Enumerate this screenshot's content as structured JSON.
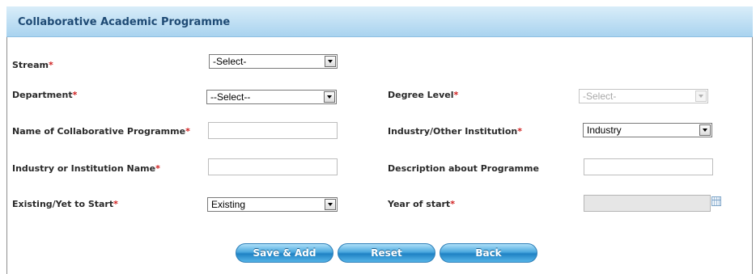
{
  "panel": {
    "title": "Collaborative Academic Programme"
  },
  "form": {
    "stream": {
      "label": "Stream",
      "value": "-Select-"
    },
    "department": {
      "label": "Department",
      "value": "--Select--"
    },
    "degree_level": {
      "label": "Degree Level",
      "value": "-Select-",
      "disabled": true
    },
    "programme_name": {
      "label": "Name of Collaborative Programme",
      "value": ""
    },
    "industry_institution": {
      "label": "Industry/Other Institution",
      "value": "Industry"
    },
    "institution_name": {
      "label": "Industry or Institution Name",
      "value": ""
    },
    "description": {
      "label": "Description about Programme",
      "value": ""
    },
    "existing": {
      "label": "Existing/Yet to Start",
      "value": "Existing"
    },
    "year_of_start": {
      "label": "Year of start",
      "value": ""
    },
    "required_marker": "*"
  },
  "buttons": {
    "save_add": "Save & Add",
    "reset": "Reset",
    "back": "Back"
  },
  "colors": {
    "header_bg": "#bfe0f5",
    "header_text": "#1e4a74",
    "required": "#d02020",
    "button": "#3b9ad8"
  },
  "icons": {
    "calendar": "calendar-icon",
    "dropdown": "chevron-down-icon"
  }
}
